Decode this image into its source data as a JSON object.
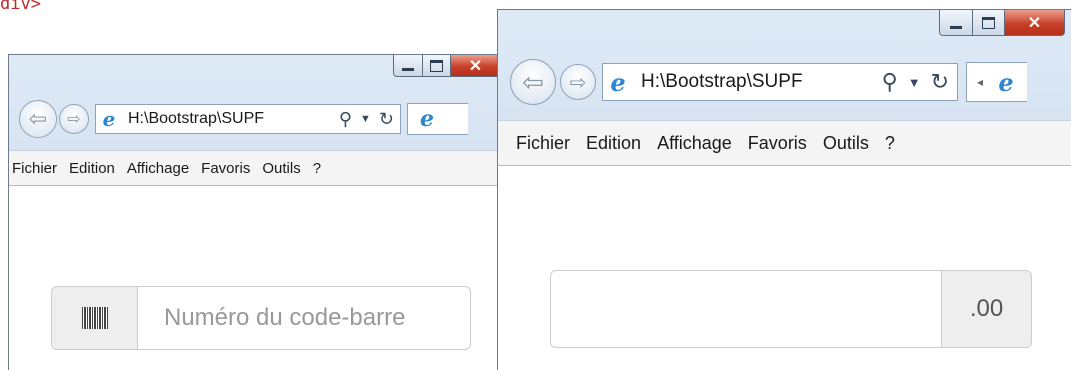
{
  "code_fragment": "div>",
  "windows": [
    {
      "address": "H:\\Bootstrap\\SUPF",
      "menu": [
        "Fichier",
        "Edition",
        "Affichage",
        "Favoris",
        "Outils",
        "?"
      ],
      "input_group": {
        "addon_icon": "barcode-icon",
        "placeholder": "Numéro du code-barre"
      }
    },
    {
      "address": "H:\\Bootstrap\\SUPF",
      "menu": [
        "Fichier",
        "Edition",
        "Affichage",
        "Favoris",
        "Outils",
        "?"
      ],
      "input_group": {
        "value": "",
        "addon_text": ".00"
      }
    }
  ],
  "icons": {
    "back": "back-arrow-icon",
    "forward": "forward-arrow-icon",
    "page": "ie-logo-icon",
    "search": "search-icon",
    "dropdown": "chevron-down-icon",
    "refresh": "refresh-icon",
    "minimize": "minimize-icon",
    "maximize": "maximize-icon",
    "close": "close-icon"
  },
  "colors": {
    "close_button": "#c8402a",
    "ie_logo": "#2d86d0",
    "code_fragment": "#c0282d"
  }
}
